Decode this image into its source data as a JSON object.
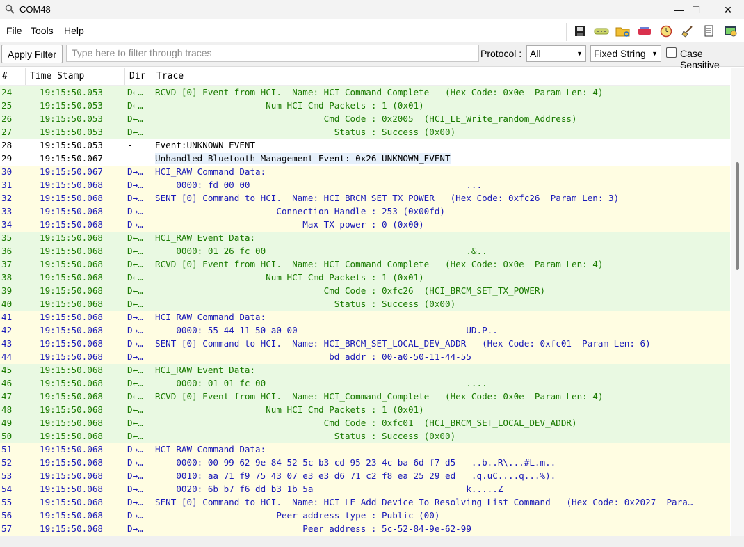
{
  "window": {
    "title": "COM48",
    "minimize": "—",
    "maximize": "☐",
    "close": "✕"
  },
  "menu": {
    "file": "File",
    "tools": "Tools",
    "help": "Help"
  },
  "toolbar_icons": [
    "save-icon",
    "serial-port-icon",
    "open-folder-icon",
    "capture-icon",
    "clock-icon",
    "clear-icon",
    "log-icon",
    "config-icon"
  ],
  "filter": {
    "apply_label": "Apply Filter",
    "placeholder": "Type here to filter through traces",
    "protocol_label": "Protocol :",
    "protocol_value": "All",
    "mode_value": "Fixed String",
    "case_label": "Case Sensitive"
  },
  "columns": {
    "num": "#",
    "timestamp": "Time Stamp",
    "dir": "Dir",
    "trace": "Trace"
  },
  "colors": {
    "green_bg": "#e9f9e2",
    "yellow_bg": "#fffde2",
    "white_bg": "#ffffff",
    "green_text": "#1a7a00",
    "blue_text": "#1a1ab8",
    "highlight": "#e6f0fb"
  },
  "rows": [
    {
      "num": "24",
      "ts": "19:15:50.053",
      "dir": "D←…",
      "trace": "RCVD [0] Event from HCI.  Name: HCI_Command_Complete   (Hex Code: 0x0e  Param Len: 4)",
      "kind": "rx"
    },
    {
      "num": "25",
      "ts": "19:15:50.053",
      "dir": "D←…",
      "trace": "                     Num HCI Cmd Packets : 1 (0x01)",
      "kind": "rx"
    },
    {
      "num": "26",
      "ts": "19:15:50.053",
      "dir": "D←…",
      "trace": "                                Cmd Code : 0x2005  (HCI_LE_Write_random_Address)",
      "kind": "rx"
    },
    {
      "num": "27",
      "ts": "19:15:50.053",
      "dir": "D←…",
      "trace": "                                  Status : Success (0x00)",
      "kind": "rx"
    },
    {
      "num": "28",
      "ts": "19:15:50.053",
      "dir": "-",
      "trace": "Event:UNKNOWN_EVENT",
      "kind": "plain"
    },
    {
      "num": "29",
      "ts": "19:15:50.067",
      "dir": "-",
      "trace": "Unhandled Bluetooth Management Event: 0x26 UNKNOWN_EVENT",
      "kind": "plain-hl"
    },
    {
      "num": "30",
      "ts": "19:15:50.067",
      "dir": "D→…",
      "trace": "HCI_RAW Command Data:",
      "kind": "tx"
    },
    {
      "num": "31",
      "ts": "19:15:50.068",
      "dir": "D→…",
      "trace": "    0000: fd 00 00                                         ...",
      "kind": "tx"
    },
    {
      "num": "32",
      "ts": "19:15:50.068",
      "dir": "D→…",
      "trace": "SENT [0] Command to HCI.  Name: HCI_BRCM_SET_TX_POWER   (Hex Code: 0xfc26  Param Len: 3)",
      "kind": "tx"
    },
    {
      "num": "33",
      "ts": "19:15:50.068",
      "dir": "D→…",
      "trace": "                       Connection_Handle : 253 (0x00fd)",
      "kind": "tx"
    },
    {
      "num": "34",
      "ts": "19:15:50.068",
      "dir": "D→…",
      "trace": "                            Max TX power : 0 (0x00)",
      "kind": "tx"
    },
    {
      "num": "35",
      "ts": "19:15:50.068",
      "dir": "D←…",
      "trace": "HCI_RAW Event Data:",
      "kind": "rx"
    },
    {
      "num": "36",
      "ts": "19:15:50.068",
      "dir": "D←…",
      "trace": "    0000: 01 26 fc 00                                      .&..",
      "kind": "rx"
    },
    {
      "num": "37",
      "ts": "19:15:50.068",
      "dir": "D←…",
      "trace": "RCVD [0] Event from HCI.  Name: HCI_Command_Complete   (Hex Code: 0x0e  Param Len: 4)",
      "kind": "rx"
    },
    {
      "num": "38",
      "ts": "19:15:50.068",
      "dir": "D←…",
      "trace": "                     Num HCI Cmd Packets : 1 (0x01)",
      "kind": "rx"
    },
    {
      "num": "39",
      "ts": "19:15:50.068",
      "dir": "D←…",
      "trace": "                                Cmd Code : 0xfc26  (HCI_BRCM_SET_TX_POWER)",
      "kind": "rx"
    },
    {
      "num": "40",
      "ts": "19:15:50.068",
      "dir": "D←…",
      "trace": "                                  Status : Success (0x00)",
      "kind": "rx"
    },
    {
      "num": "41",
      "ts": "19:15:50.068",
      "dir": "D→…",
      "trace": "HCI_RAW Command Data:",
      "kind": "tx"
    },
    {
      "num": "42",
      "ts": "19:15:50.068",
      "dir": "D→…",
      "trace": "    0000: 55 44 11 50 a0 00                                UD.P..",
      "kind": "tx"
    },
    {
      "num": "43",
      "ts": "19:15:50.068",
      "dir": "D→…",
      "trace": "SENT [0] Command to HCI.  Name: HCI_BRCM_SET_LOCAL_DEV_ADDR   (Hex Code: 0xfc01  Param Len: 6)",
      "kind": "tx"
    },
    {
      "num": "44",
      "ts": "19:15:50.068",
      "dir": "D→…",
      "trace": "                                 bd addr : 00-a0-50-11-44-55",
      "kind": "tx"
    },
    {
      "num": "45",
      "ts": "19:15:50.068",
      "dir": "D←…",
      "trace": "HCI_RAW Event Data:",
      "kind": "rx"
    },
    {
      "num": "46",
      "ts": "19:15:50.068",
      "dir": "D←…",
      "trace": "    0000: 01 01 fc 00                                      ....",
      "kind": "rx"
    },
    {
      "num": "47",
      "ts": "19:15:50.068",
      "dir": "D←…",
      "trace": "RCVD [0] Event from HCI.  Name: HCI_Command_Complete   (Hex Code: 0x0e  Param Len: 4)",
      "kind": "rx"
    },
    {
      "num": "48",
      "ts": "19:15:50.068",
      "dir": "D←…",
      "trace": "                     Num HCI Cmd Packets : 1 (0x01)",
      "kind": "rx"
    },
    {
      "num": "49",
      "ts": "19:15:50.068",
      "dir": "D←…",
      "trace": "                                Cmd Code : 0xfc01  (HCI_BRCM_SET_LOCAL_DEV_ADDR)",
      "kind": "rx"
    },
    {
      "num": "50",
      "ts": "19:15:50.068",
      "dir": "D←…",
      "trace": "                                  Status : Success (0x00)",
      "kind": "rx"
    },
    {
      "num": "51",
      "ts": "19:15:50.068",
      "dir": "D→…",
      "trace": "HCI_RAW Command Data:",
      "kind": "tx"
    },
    {
      "num": "52",
      "ts": "19:15:50.068",
      "dir": "D→…",
      "trace": "    0000: 00 99 62 9e 84 52 5c b3 cd 95 23 4c ba 6d f7 d5   ..b..R\\...#L.m..",
      "kind": "tx"
    },
    {
      "num": "53",
      "ts": "19:15:50.068",
      "dir": "D→…",
      "trace": "    0010: aa 71 f9 75 43 07 e3 e3 d6 71 c2 f8 ea 25 29 ed   .q.uC....q...%).",
      "kind": "tx"
    },
    {
      "num": "54",
      "ts": "19:15:50.068",
      "dir": "D→…",
      "trace": "    0020: 6b b7 f6 dd b3 1b 5a                             k.....Z",
      "kind": "tx"
    },
    {
      "num": "55",
      "ts": "19:15:50.068",
      "dir": "D→…",
      "trace": "SENT [0] Command to HCI.  Name: HCI_LE_Add_Device_To_Resolving_List_Command   (Hex Code: 0x2027  Para…",
      "kind": "tx"
    },
    {
      "num": "56",
      "ts": "19:15:50.068",
      "dir": "D→…",
      "trace": "                       Peer address type : Public (00)",
      "kind": "tx"
    },
    {
      "num": "57",
      "ts": "19:15:50.068",
      "dir": "D→…",
      "trace": "                            Peer address : 5c-52-84-9e-62-99",
      "kind": "tx"
    }
  ]
}
